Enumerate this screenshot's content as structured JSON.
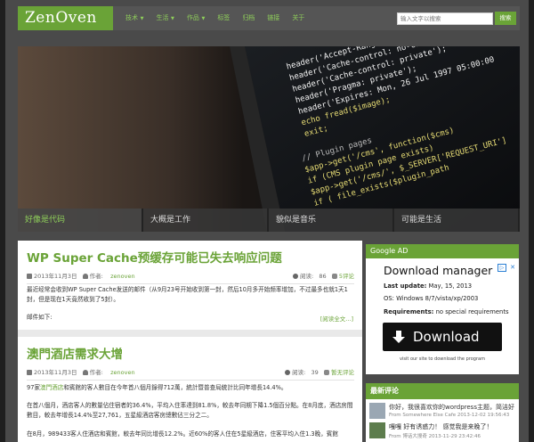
{
  "site": {
    "logo": "ZenOven"
  },
  "nav": [
    {
      "label": "技术",
      "caret": true
    },
    {
      "label": "生活",
      "caret": true
    },
    {
      "label": "作品",
      "caret": true
    },
    {
      "label": "标签",
      "caret": false
    },
    {
      "label": "归档",
      "caret": false
    },
    {
      "label": "链接",
      "caret": false
    },
    {
      "label": "关于",
      "caret": false
    }
  ],
  "search": {
    "placeholder": "输入文字以搜索",
    "button": "搜索"
  },
  "hero_tabs": [
    "好像是代码",
    "大概是工作",
    "貌似是音乐",
    "可能是生活"
  ],
  "code_lines": [
    "header('Accept-Ranges: bytes');",
    "header('Cache-control: no-cache,",
    "header('Cache-control: private');",
    "header('Pragma: private');",
    "header('Expires: Mon, 26 Jul 1997 05:00:00",
    "echo fread($image);",
    "exit;",
    "",
    "// Plugin pages",
    "$app->get('/cms', function($cms)",
    "if (CMS plugin page exists)",
    "$app->get('/cms/', $_SERVER['REQUEST_URI']",
    "if ( file_exists($plugin_path"
  ],
  "posts": [
    {
      "title": "WP Super Cache预缓存可能已失去响应问题",
      "date": "2013年11月3日",
      "author_label": "作者:",
      "author": "zenoven",
      "views_label": "阅读:",
      "views": "86",
      "comments": "5评论",
      "body1": "最近经常会收到WP Super Cache发送的邮件（从9月23号开始收到第一封，然后10月多开始频率增加，不过最多也就1天1封，但是现在1天竟然收到了5封）。",
      "body2": "邮件如下:",
      "read_more": "[阅读全文...]"
    },
    {
      "title": "澳門酒店需求大增",
      "date": "2013年11月3日",
      "author_label": "作者:",
      "author": "zenoven",
      "views_label": "阅读:",
      "views": "39",
      "comments": "暂无评论",
      "body1_pre": "97家",
      "body1_link": "澳門酒店",
      "body1_post": "和賓館的客人數目在今年首八個月錄得712萬，統計暨普查局統計比同年增長14.4%。",
      "body2": "在首八個月，酒店客人的數量佔住宿者的36.4%，平均入住率達到81.8%，較去年同期下降1.5個百分點。在8月底，酒店房間數目，較去年增長14.4%至27,761，五星級酒店客房總數佔三分之二。",
      "body3": "在8月，989433客人住酒店和賓館，較去年同比增長12.2%。近60%的客人住在5星級酒店，住客平均入住1.3晚，賓館"
    }
  ],
  "sidebar": {
    "ad_head": "Google AD",
    "ad": {
      "title": "Download manager",
      "last_update_label": "Last update:",
      "last_update": "May, 15, 2013",
      "os_label": "OS:",
      "os": "Windows 8/7/vista/xp/2003",
      "req_label": "Requirements:",
      "req": "no special requirements",
      "button": "Download",
      "foot": "visit our site to download the program"
    },
    "comments_head": "最新评论",
    "comments": [
      {
        "text": "你好，我很喜欢你的wordpress主题，简洁好",
        "meta": "From Somewhere Else Cafe  2013-12-02 19:56:43"
      },
      {
        "text": "嘎嘎 好有诱惑力！ 感觉我是来晚了！",
        "meta": "From 博话大搜奇  2013-11-29 23:42:46"
      }
    ]
  },
  "colors": {
    "accent": "#6aa337",
    "bar": "#555555",
    "page_bg": "#4a4a4a"
  }
}
